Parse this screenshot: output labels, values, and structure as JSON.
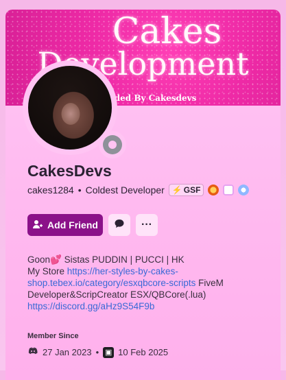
{
  "banner": {
    "title_line1": "Cakes",
    "title_line2": "Development",
    "subtitle": "nded By Cakesdevs"
  },
  "profile": {
    "display_name": "CakesDevs",
    "username": "cakes1284",
    "separator": "•",
    "status_text": "Coldest Developer",
    "guild_tag": "GSF",
    "guild_tag_icon": "lightning",
    "badges": [
      "nitro-badge-icon",
      "quest-badge-icon",
      "gear-badge-icon"
    ]
  },
  "actions": {
    "add_friend_label": "Add Friend",
    "message_icon": "chat-bubble-icon",
    "more_icon": "ellipsis-icon",
    "more_label": "···"
  },
  "bio": {
    "line1_prefix": "Goon",
    "line1_emoji": "💕",
    "line1_suffix": " Sistas PUDDIN | PUCCI | HK",
    "line2_prefix": "My Store ",
    "store_link": "https://her-styles-by-cakes-shop.tebex.io/category/esxqbcore-scripts",
    "line2_suffix": " FiveM Developer&ScripCreator ESX/QBCore(.lua)",
    "discord_link": "https://discord.gg/aHz9S54F9b"
  },
  "member_since": {
    "label": "Member Since",
    "discord_date": "27 Jan 2023",
    "separator": "•",
    "server_date": "10 Feb 2025"
  },
  "colors": {
    "primary_button": "#8b1189",
    "link": "#3869d6",
    "banner": "#ee2aa6"
  }
}
